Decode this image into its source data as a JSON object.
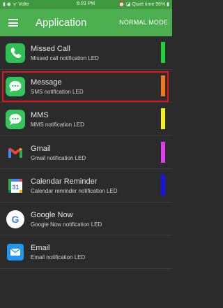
{
  "status_bar": {
    "left": "▮ ◉ ᯤ Volte",
    "time": "6:03 PM",
    "right": "⏰ ◪ Quiet time 96% ▮"
  },
  "app_bar": {
    "title": "Application",
    "mode_button": "NORMAL MODE"
  },
  "items": [
    {
      "title": "Missed Call",
      "subtitle": "Missed call notification LED",
      "icon": "phone-icon",
      "led_color": "#22d33a"
    },
    {
      "title": "Message",
      "subtitle": "SMS notification LED",
      "icon": "message-icon",
      "led_color": "#f07a1b",
      "selected": true
    },
    {
      "title": "MMS",
      "subtitle": "MMS notification LED",
      "icon": "mms-icon",
      "led_color": "#f4f20e"
    },
    {
      "title": "Gmail",
      "subtitle": "Gmail notification LED",
      "icon": "gmail-icon",
      "led_color": "#e13cf0"
    },
    {
      "title": "Calendar Reminder",
      "subtitle": "Calendar reminder notification LED",
      "icon": "calendar-icon",
      "calendar_day": "31",
      "led_color": "#1515e8"
    },
    {
      "title": "Google Now",
      "subtitle": "Google Now notification LED",
      "icon": "google-icon",
      "google_letter": "G"
    },
    {
      "title": "Email",
      "subtitle": "Email notification LED",
      "icon": "email-icon"
    }
  ]
}
